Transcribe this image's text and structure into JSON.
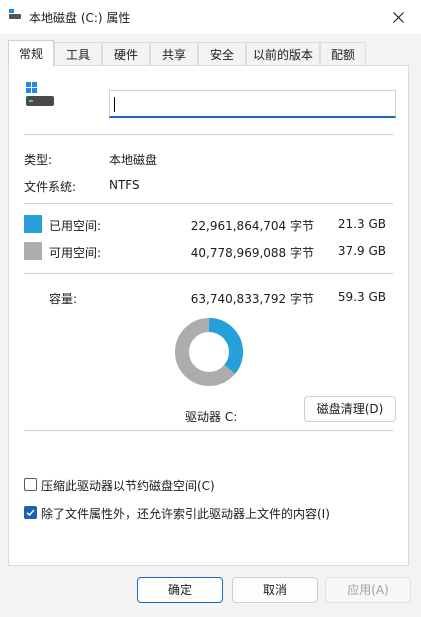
{
  "window": {
    "title": "本地磁盘 (C:) 属性"
  },
  "tabs": [
    {
      "label": "常规",
      "active": true
    },
    {
      "label": "工具",
      "active": false
    },
    {
      "label": "硬件",
      "active": false
    },
    {
      "label": "共享",
      "active": false
    },
    {
      "label": "安全",
      "active": false
    },
    {
      "label": "以前的版本",
      "active": false
    },
    {
      "label": "配额",
      "active": false
    }
  ],
  "general": {
    "name_value": "",
    "type_label": "类型:",
    "type_value": "本地磁盘",
    "fs_label": "文件系统:",
    "fs_value": "NTFS",
    "used": {
      "label": "已用空间:",
      "bytes": "22,961,864,704 字节",
      "size": "21.3 GB",
      "color": "#26a0da",
      "fraction": 0.36
    },
    "free": {
      "label": "可用空间:",
      "bytes": "40,778,969,088 字节",
      "size": "37.9 GB",
      "color": "#adadad"
    },
    "capacity": {
      "label": "容量:",
      "bytes": "63,740,833,792 字节",
      "size": "59.3 GB"
    },
    "drive_label": "驱动器 C:",
    "cleanup_button": "磁盘清理(D)",
    "compress_checkbox": {
      "label": "压缩此驱动器以节约磁盘空间(C)",
      "checked": false
    },
    "index_checkbox": {
      "label": "除了文件属性外，还允许索引此驱动器上文件的内容(I)",
      "checked": true
    }
  },
  "footer": {
    "ok": "确定",
    "cancel": "取消",
    "apply": "应用(A)"
  },
  "colors": {
    "accent": "#1d69b6",
    "used": "#26a0da",
    "free": "#adadad"
  }
}
